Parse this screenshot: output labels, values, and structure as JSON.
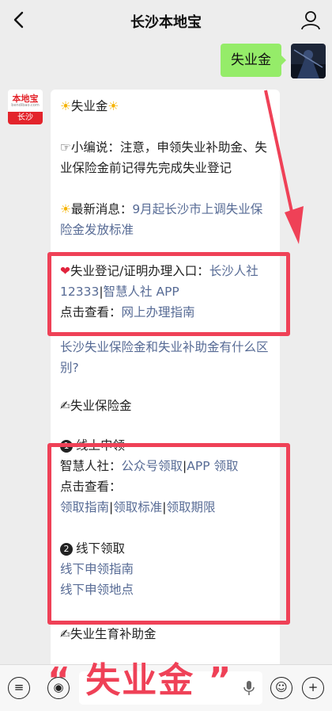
{
  "header": {
    "title": "长沙本地宝"
  },
  "my_message": {
    "text": "失业金"
  },
  "bot_avatar": {
    "logo_line1": "本地宝",
    "logo_line2": "bendibao.com",
    "city_tag": "长沙"
  },
  "reply": {
    "title_sun_left": "☀",
    "title": "失业金",
    "title_sun_right": "☀",
    "editor_prefix": "☞",
    "editor_note": "小编说：注意，申领失业补助金、失业保险金前记得先完成失业登记",
    "news_icon": "☀",
    "news_label": "最新消息：",
    "news_link": "9月起长沙市上调失业保险金发放标准",
    "heart_icon": "❤",
    "entry_label": "失业登记/证明办理入口：",
    "entry_link1": "长沙人社 12333",
    "sep1": "|",
    "entry_link2": "智慧人社 APP",
    "view_label": "点击查看：",
    "view_link": "网上办理指南",
    "question_link": "长沙失业保险金和失业补助金有什么区别?",
    "section1_icon": "✍",
    "section1_title": "失业保险金",
    "online_num": "1",
    "online_title": "线上申领",
    "smart_label": "智慧人社：",
    "smart_link1": "公众号领取",
    "sep2": "|",
    "smart_link2": "APP 领取",
    "view2_label": "点击查看：",
    "guide_link1": "领取指南",
    "sep3": "|",
    "guide_link2": "领取标准",
    "sep4": "|",
    "guide_link3": "领取期限",
    "offline_num": "2",
    "offline_title": "线下领取",
    "offline_link1": "线下申领指南",
    "offline_link2": "线下申领地点",
    "section2_icon": "✍",
    "section2_title": "失业生育补助金"
  },
  "overlay_caption": {
    "text": "“ 失业金 ”"
  },
  "colors": {
    "highlight": "#ef4157",
    "link": "#576b95",
    "bubble_green": "#95ec69"
  }
}
